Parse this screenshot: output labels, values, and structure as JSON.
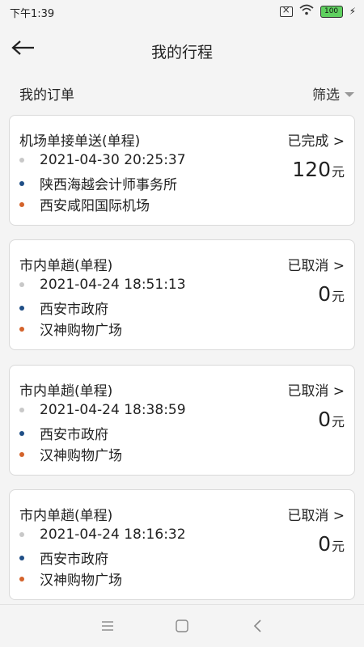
{
  "status_bar": {
    "time": "下午1:39",
    "battery": "100"
  },
  "header": {
    "title": "我的行程"
  },
  "list": {
    "title": "我的订单",
    "filter_label": "筛选"
  },
  "orders": [
    {
      "type": "机场单接单送(单程)",
      "status": "已完成 >",
      "datetime": "2021-04-30 20:25:37",
      "start": "陕西海越会计师事务所",
      "end": "西安咸阳国际机场",
      "price": "120",
      "unit": "元"
    },
    {
      "type": "市内单趟(单程)",
      "status": "已取消 >",
      "datetime": "2021-04-24 18:51:13",
      "start": "西安市政府",
      "end": "汉神购物广场",
      "price": "0",
      "unit": "元"
    },
    {
      "type": "市内单趟(单程)",
      "status": "已取消 >",
      "datetime": "2021-04-24 18:38:59",
      "start": "西安市政府",
      "end": "汉神购物广场",
      "price": "0",
      "unit": "元"
    },
    {
      "type": "市内单趟(单程)",
      "status": "已取消 >",
      "datetime": "2021-04-24 18:16:32",
      "start": "西安市政府",
      "end": "汉神购物广场",
      "price": "0",
      "unit": "元"
    }
  ],
  "colors": {
    "start_dot": "#1f4e86",
    "end_dot": "#d4632b",
    "time_dot": "#c8c8c8"
  }
}
